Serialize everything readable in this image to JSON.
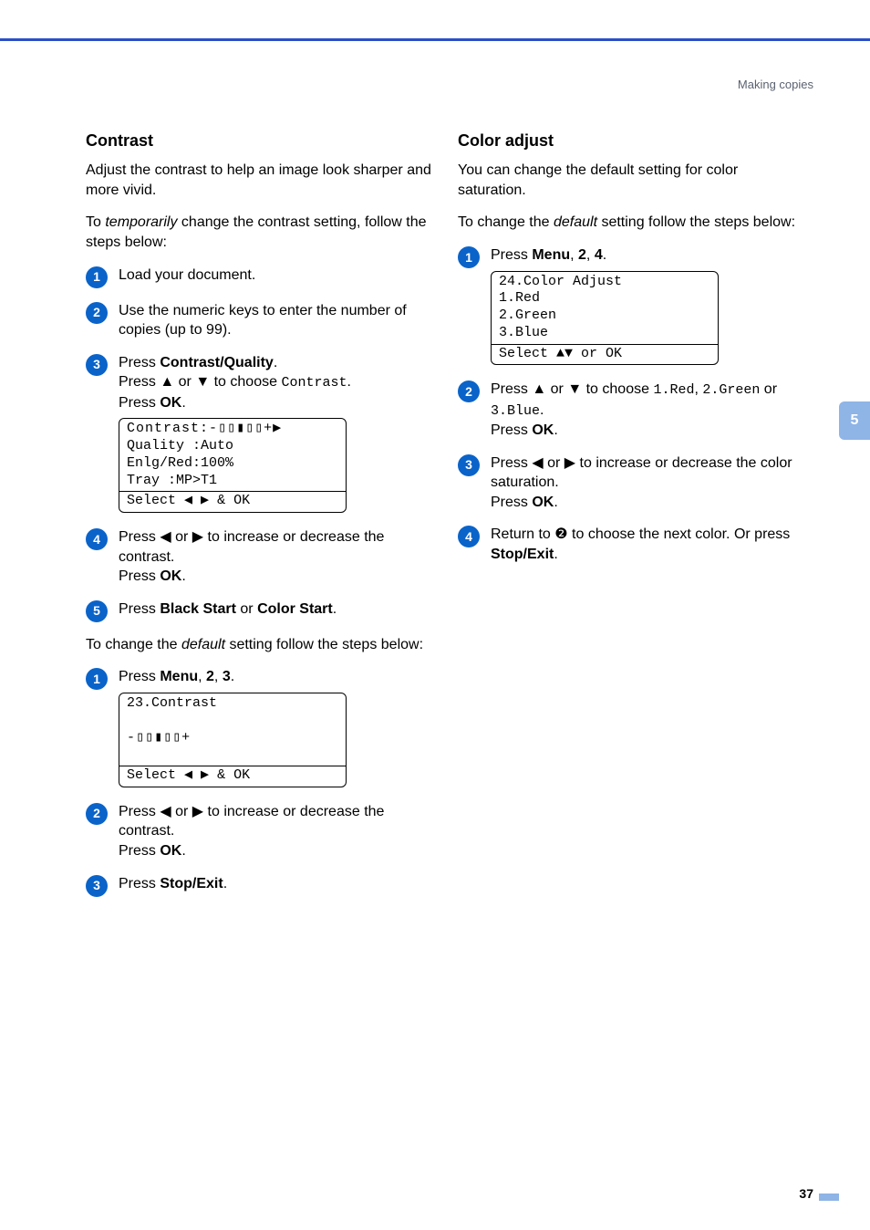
{
  "header": {
    "breadcrumb": "Making copies"
  },
  "side_tab": "5",
  "footer": {
    "page": "37"
  },
  "left": {
    "heading": "Contrast",
    "intro": "Adjust the contrast to help an image look sharper and more vivid.",
    "temp_lead_a": "To ",
    "temp_lead_i": "temporarily",
    "temp_lead_b": " change the contrast setting, follow the steps below:",
    "s1": "Load your document.",
    "s2": "Use the numeric keys to enter the number of copies (up to 99).",
    "s3_a": "Press ",
    "s3_b": "Contrast/Quality",
    "s3_c": ".",
    "s3_d": "Press ",
    "s3_up": "▲",
    "s3_e": " or ",
    "s3_dn": "▼",
    "s3_f": " to choose ",
    "s3_g": "Contrast",
    "s3_h": ".",
    "s3_i": "Press ",
    "s3_j": "OK",
    "s3_k": ".",
    "lcd1_l1": "Contrast:-▯▯▮▯▯+▶",
    "lcd1_l2": "Quality :Auto",
    "lcd1_l3": "Enlg/Red:100%",
    "lcd1_l4": "Tray    :MP>T1",
    "lcd1_ft": "Select ◀ ▶ & OK",
    "s4_a": "Press ",
    "s4_l": "◀",
    "s4_b": " or ",
    "s4_r": "▶",
    "s4_c": " to increase or decrease the contrast.",
    "s4_d": "Press ",
    "s4_e": "OK",
    "s4_f": ".",
    "s5_a": "Press ",
    "s5_b": "Black Start",
    "s5_c": " or ",
    "s5_d": "Color Start",
    "s5_e": ".",
    "def_lead_a": "To change the ",
    "def_lead_i": "default",
    "def_lead_b": " setting follow the steps below:",
    "d1_a": "Press ",
    "d1_b": "Menu",
    "d1_c": ", ",
    "d1_d": "2",
    "d1_e": ", ",
    "d1_f": "3",
    "d1_g": ".",
    "lcd2_l1": "23.Contrast",
    "lcd2_l2": "",
    "lcd2_l3": "      -▯▯▮▯▯+",
    "lcd2_l4": "",
    "lcd2_ft": "Select ◀ ▶ & OK",
    "d2_a": "Press ",
    "d2_l": "◀",
    "d2_b": " or ",
    "d2_r": "▶",
    "d2_c": " to increase or decrease the contrast.",
    "d2_d": "Press ",
    "d2_e": "OK",
    "d2_f": ".",
    "d3_a": "Press ",
    "d3_b": "Stop/Exit",
    "d3_c": "."
  },
  "right": {
    "heading": "Color adjust",
    "intro": "You can change the default setting for color saturation.",
    "lead_a": "To change the ",
    "lead_i": "default",
    "lead_b": " setting follow the steps below:",
    "s1_a": "Press ",
    "s1_b": "Menu",
    "s1_c": ", ",
    "s1_d": "2",
    "s1_e": ", ",
    "s1_f": "4",
    "s1_g": ".",
    "lcd_l1": "24.Color Adjust",
    "lcd_l2": "  1.Red",
    "lcd_l3": "  2.Green",
    "lcd_l4": "  3.Blue",
    "lcd_ft": "Select ▲▼ or OK",
    "s2_a": "Press ",
    "s2_up": "▲",
    "s2_b": " or ",
    "s2_dn": "▼",
    "s2_c": " to choose ",
    "s2_d": "1.Red",
    "s2_e": ", ",
    "s2_f": "2.Green",
    "s2_g": " or ",
    "s2_h": "3.Blue",
    "s2_i": ".",
    "s2_j": "Press ",
    "s2_k": "OK",
    "s2_l": ".",
    "s3_a": "Press ",
    "s3_l": "◀",
    "s3_b": " or ",
    "s3_r": "▶",
    "s3_c": " to increase or decrease the color saturation.",
    "s3_d": "Press ",
    "s3_e": "OK",
    "s3_f": ".",
    "s4_a": "Return to ",
    "s4_ref": "❷",
    "s4_b": " to choose the next color. Or press ",
    "s4_c": "Stop/Exit",
    "s4_d": "."
  }
}
